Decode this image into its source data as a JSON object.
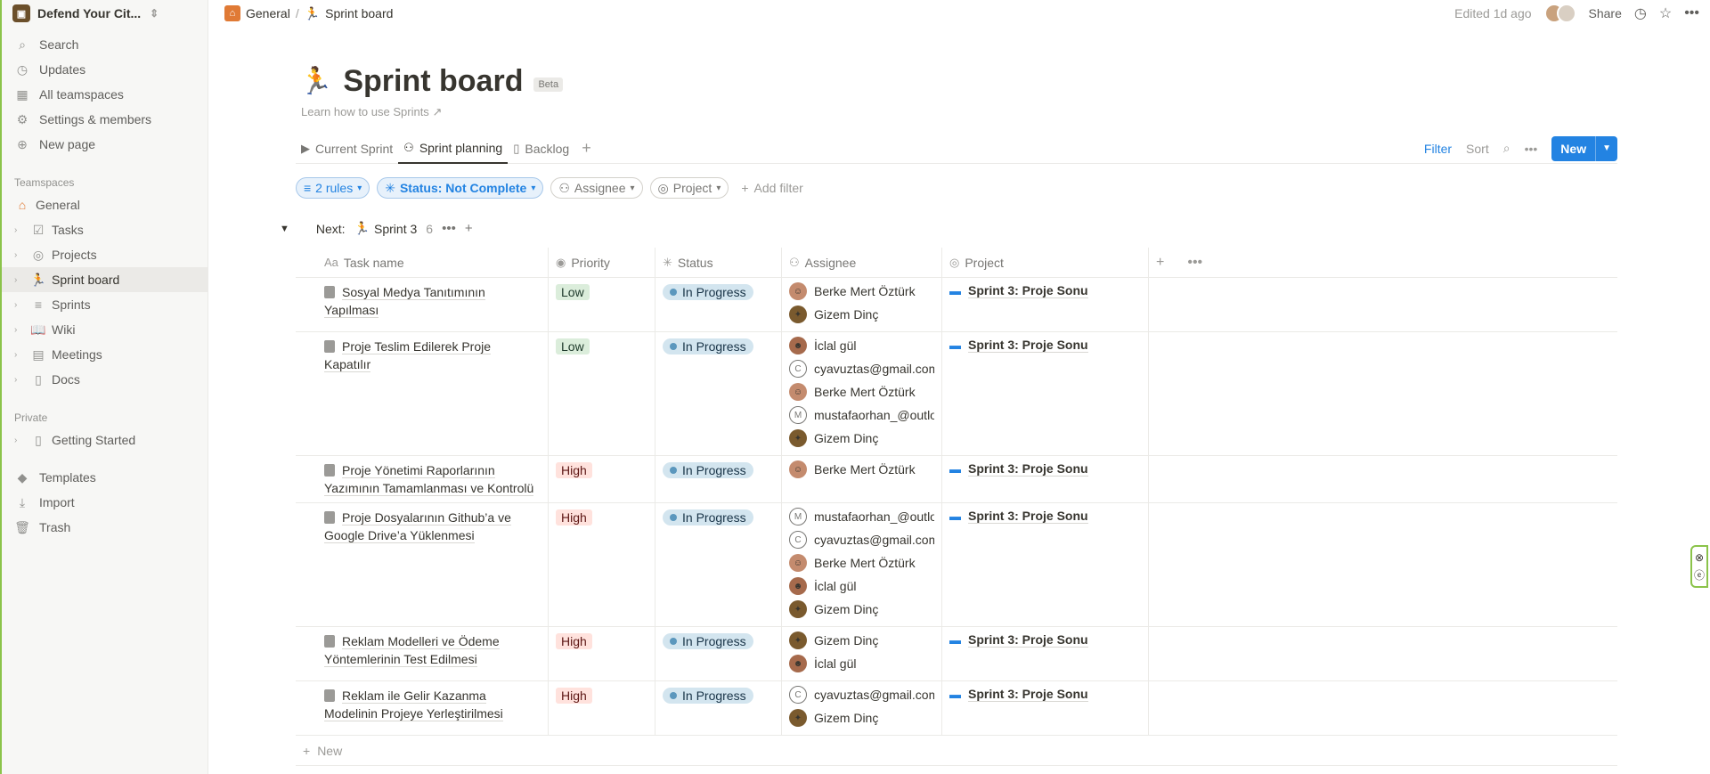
{
  "workspace": {
    "name": "Defend Your Cit..."
  },
  "sidebar": {
    "nav": [
      {
        "label": "Search",
        "icon": "search-icon"
      },
      {
        "label": "Updates",
        "icon": "clock-icon"
      },
      {
        "label": "All teamspaces",
        "icon": "grid-icon"
      },
      {
        "label": "Settings & members",
        "icon": "gear-icon"
      },
      {
        "label": "New page",
        "icon": "plus-circle-icon"
      }
    ],
    "teamspaces_label": "Teamspaces",
    "teamspaces": [
      {
        "label": "General",
        "icon": "home-icon"
      },
      {
        "label": "Tasks",
        "icon": "checkbox-icon"
      },
      {
        "label": "Projects",
        "icon": "target-icon"
      },
      {
        "label": "Sprint board",
        "icon": "runner-icon"
      },
      {
        "label": "Sprints",
        "icon": "stack-icon"
      },
      {
        "label": "Wiki",
        "icon": "book-icon"
      },
      {
        "label": "Meetings",
        "icon": "calendar-icon"
      },
      {
        "label": "Docs",
        "icon": "doc-icon"
      }
    ],
    "private_label": "Private",
    "private": [
      {
        "label": "Getting Started",
        "icon": "page-icon"
      }
    ],
    "bottom": [
      {
        "label": "Templates",
        "icon": "shapes-icon"
      },
      {
        "label": "Import",
        "icon": "download-icon"
      },
      {
        "label": "Trash",
        "icon": "trash-icon"
      }
    ]
  },
  "topbar": {
    "breadcrumb": [
      "General",
      "Sprint board"
    ],
    "breadcrumb_sep": "/",
    "edited": "Edited 1d ago",
    "share": "Share"
  },
  "page": {
    "title": "Sprint board",
    "badge": "Beta",
    "learn": "Learn how to use Sprints"
  },
  "tabs": [
    {
      "label": "Current Sprint",
      "icon": "play-icon"
    },
    {
      "label": "Sprint planning",
      "icon": "people-icon"
    },
    {
      "label": "Backlog",
      "icon": "book-icon"
    }
  ],
  "view_actions": {
    "filter": "Filter",
    "sort": "Sort",
    "new": "New"
  },
  "filters": {
    "rules": "2 rules",
    "status": "Status: Not Complete",
    "assignee": "Assignee",
    "project": "Project",
    "add": "Add filter"
  },
  "group": {
    "prefix": "Next:",
    "name": "Sprint 3",
    "count": "6"
  },
  "columns": [
    "Task name",
    "Priority",
    "Status",
    "Assignee",
    "Project"
  ],
  "column_prefix": "Aa",
  "rows": [
    {
      "task": "Sosyal Medya Tanıtımının Yapılması",
      "priority": "Low",
      "priority_level": "low",
      "status": "In Progress",
      "assignees": [
        {
          "name": "Berke Mert Öztürk",
          "avatar": "berke"
        },
        {
          "name": "Gizem Dinç",
          "avatar": "gizem"
        }
      ],
      "project": "Sprint 3: Proje Sonu"
    },
    {
      "task": "Proje Teslim Edilerek Proje Kapatılır",
      "priority": "Low",
      "priority_level": "low",
      "status": "In Progress",
      "assignees": [
        {
          "name": "İclal gül",
          "avatar": "iclal"
        },
        {
          "name": "cyavuztas@gmail.com",
          "avatar": "letter",
          "letter": "C"
        },
        {
          "name": "Berke Mert Öztürk",
          "avatar": "berke"
        },
        {
          "name": "mustafaorhan_@outloo",
          "avatar": "letter",
          "letter": "M"
        },
        {
          "name": "Gizem Dinç",
          "avatar": "gizem"
        }
      ],
      "project": "Sprint 3: Proje Sonu"
    },
    {
      "task": "Proje Yönetimi Raporlarının Yazımının Tamamlanması ve Kontrolü",
      "priority": "High",
      "priority_level": "high",
      "status": "In Progress",
      "assignees": [
        {
          "name": "Berke Mert Öztürk",
          "avatar": "berke"
        }
      ],
      "project": "Sprint 3: Proje Sonu"
    },
    {
      "task": "Proje Dosyalarının Github’a ve Google Drive’a Yüklenmesi",
      "priority": "High",
      "priority_level": "high",
      "status": "In Progress",
      "assignees": [
        {
          "name": "mustafaorhan_@outloo",
          "avatar": "letter",
          "letter": "M"
        },
        {
          "name": "cyavuztas@gmail.com",
          "avatar": "letter",
          "letter": "C"
        },
        {
          "name": "Berke Mert Öztürk",
          "avatar": "berke"
        },
        {
          "name": "İclal gül",
          "avatar": "iclal"
        },
        {
          "name": "Gizem Dinç",
          "avatar": "gizem"
        }
      ],
      "project": "Sprint 3: Proje Sonu"
    },
    {
      "task": "Reklam Modelleri ve Ödeme Yöntemlerinin Test Edilmesi",
      "priority": "High",
      "priority_level": "high",
      "status": "In Progress",
      "assignees": [
        {
          "name": "Gizem Dinç",
          "avatar": "gizem"
        },
        {
          "name": "İclal gül",
          "avatar": "iclal"
        }
      ],
      "project": "Sprint 3: Proje Sonu"
    },
    {
      "task": "Reklam ile Gelir Kazanma Modelinin Projeye Yerleştirilmesi",
      "priority": "High",
      "priority_level": "high",
      "status": "In Progress",
      "assignees": [
        {
          "name": "cyavuztas@gmail.com",
          "avatar": "letter",
          "letter": "C"
        },
        {
          "name": "Gizem Dinç",
          "avatar": "gizem"
        }
      ],
      "project": "Sprint 3: Proje Sonu"
    }
  ],
  "new_row": "New",
  "colors": {
    "accent": "#2383e2",
    "status_bg": "#d3e5ef",
    "low_bg": "#dbeddb",
    "high_bg": "#ffe2dd"
  }
}
